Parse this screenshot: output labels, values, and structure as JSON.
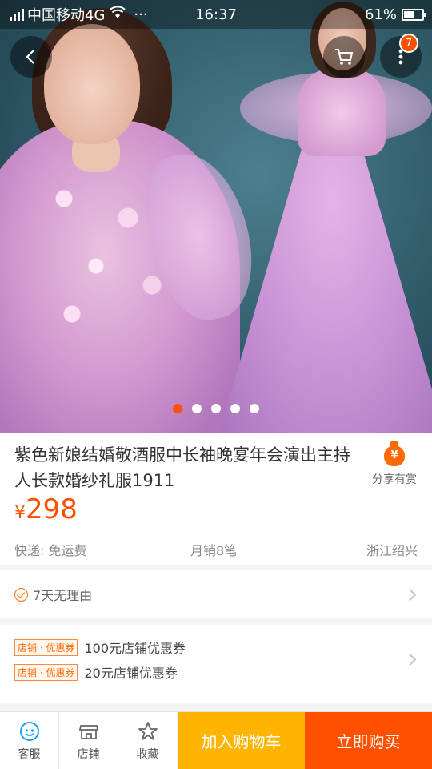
{
  "status_bar": {
    "carrier": "中国移动4G",
    "time": "16:37",
    "battery": "61%",
    "battery_level": 0.61,
    "more_glyph": "···"
  },
  "header": {
    "back_icon": "chevron-left-icon",
    "cart_icon": "cart-icon",
    "more_icon": "more-vertical-icon",
    "more_badge": "7"
  },
  "gallery": {
    "dots": 5,
    "active_dot": 0
  },
  "product": {
    "title": "紫色新娘结婚敬酒服中长袖晚宴年会演出主持人长款婚纱礼服1911",
    "price_symbol": "¥",
    "price": "298",
    "share_label": "分享有赏",
    "share_glyph": "¥",
    "shipping": "快递: 免运费",
    "monthly_sales": "月销8笔",
    "location": "浙江绍兴"
  },
  "service": {
    "label": "7天无理由"
  },
  "coupons": [
    {
      "tag": "店铺 · 优惠券",
      "text": "100元店铺优惠券"
    },
    {
      "tag": "店铺 · 优惠券",
      "text": "20元店铺优惠券"
    }
  ],
  "bottom_bar": {
    "service_label": "客服",
    "shop_label": "店铺",
    "favorite_label": "收藏",
    "add_to_cart": "加入购物车",
    "buy_now": "立即购买"
  },
  "colors": {
    "accent": "#ff5000",
    "add_cart_bg": "#ffb400"
  }
}
